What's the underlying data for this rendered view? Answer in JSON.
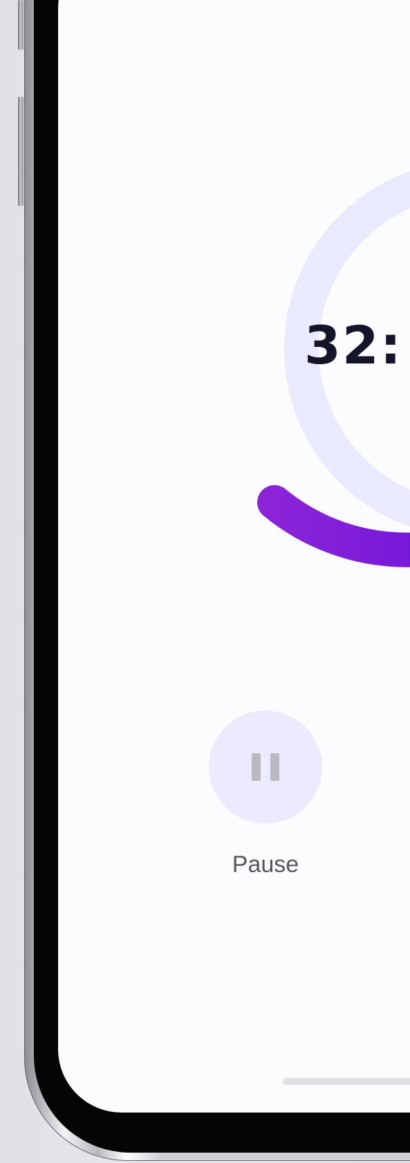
{
  "timer": {
    "time_text": "32:"
  },
  "controls": {
    "pause_label": "Pause"
  },
  "icons": {
    "pause": "pause-icon"
  },
  "colors": {
    "ring_track": "#eaeafe",
    "ring_progress_start": "#8b24d8",
    "ring_progress_end": "#6d13d9",
    "pause_button_bg": "#ebebfd",
    "time_text": "#14142a"
  }
}
